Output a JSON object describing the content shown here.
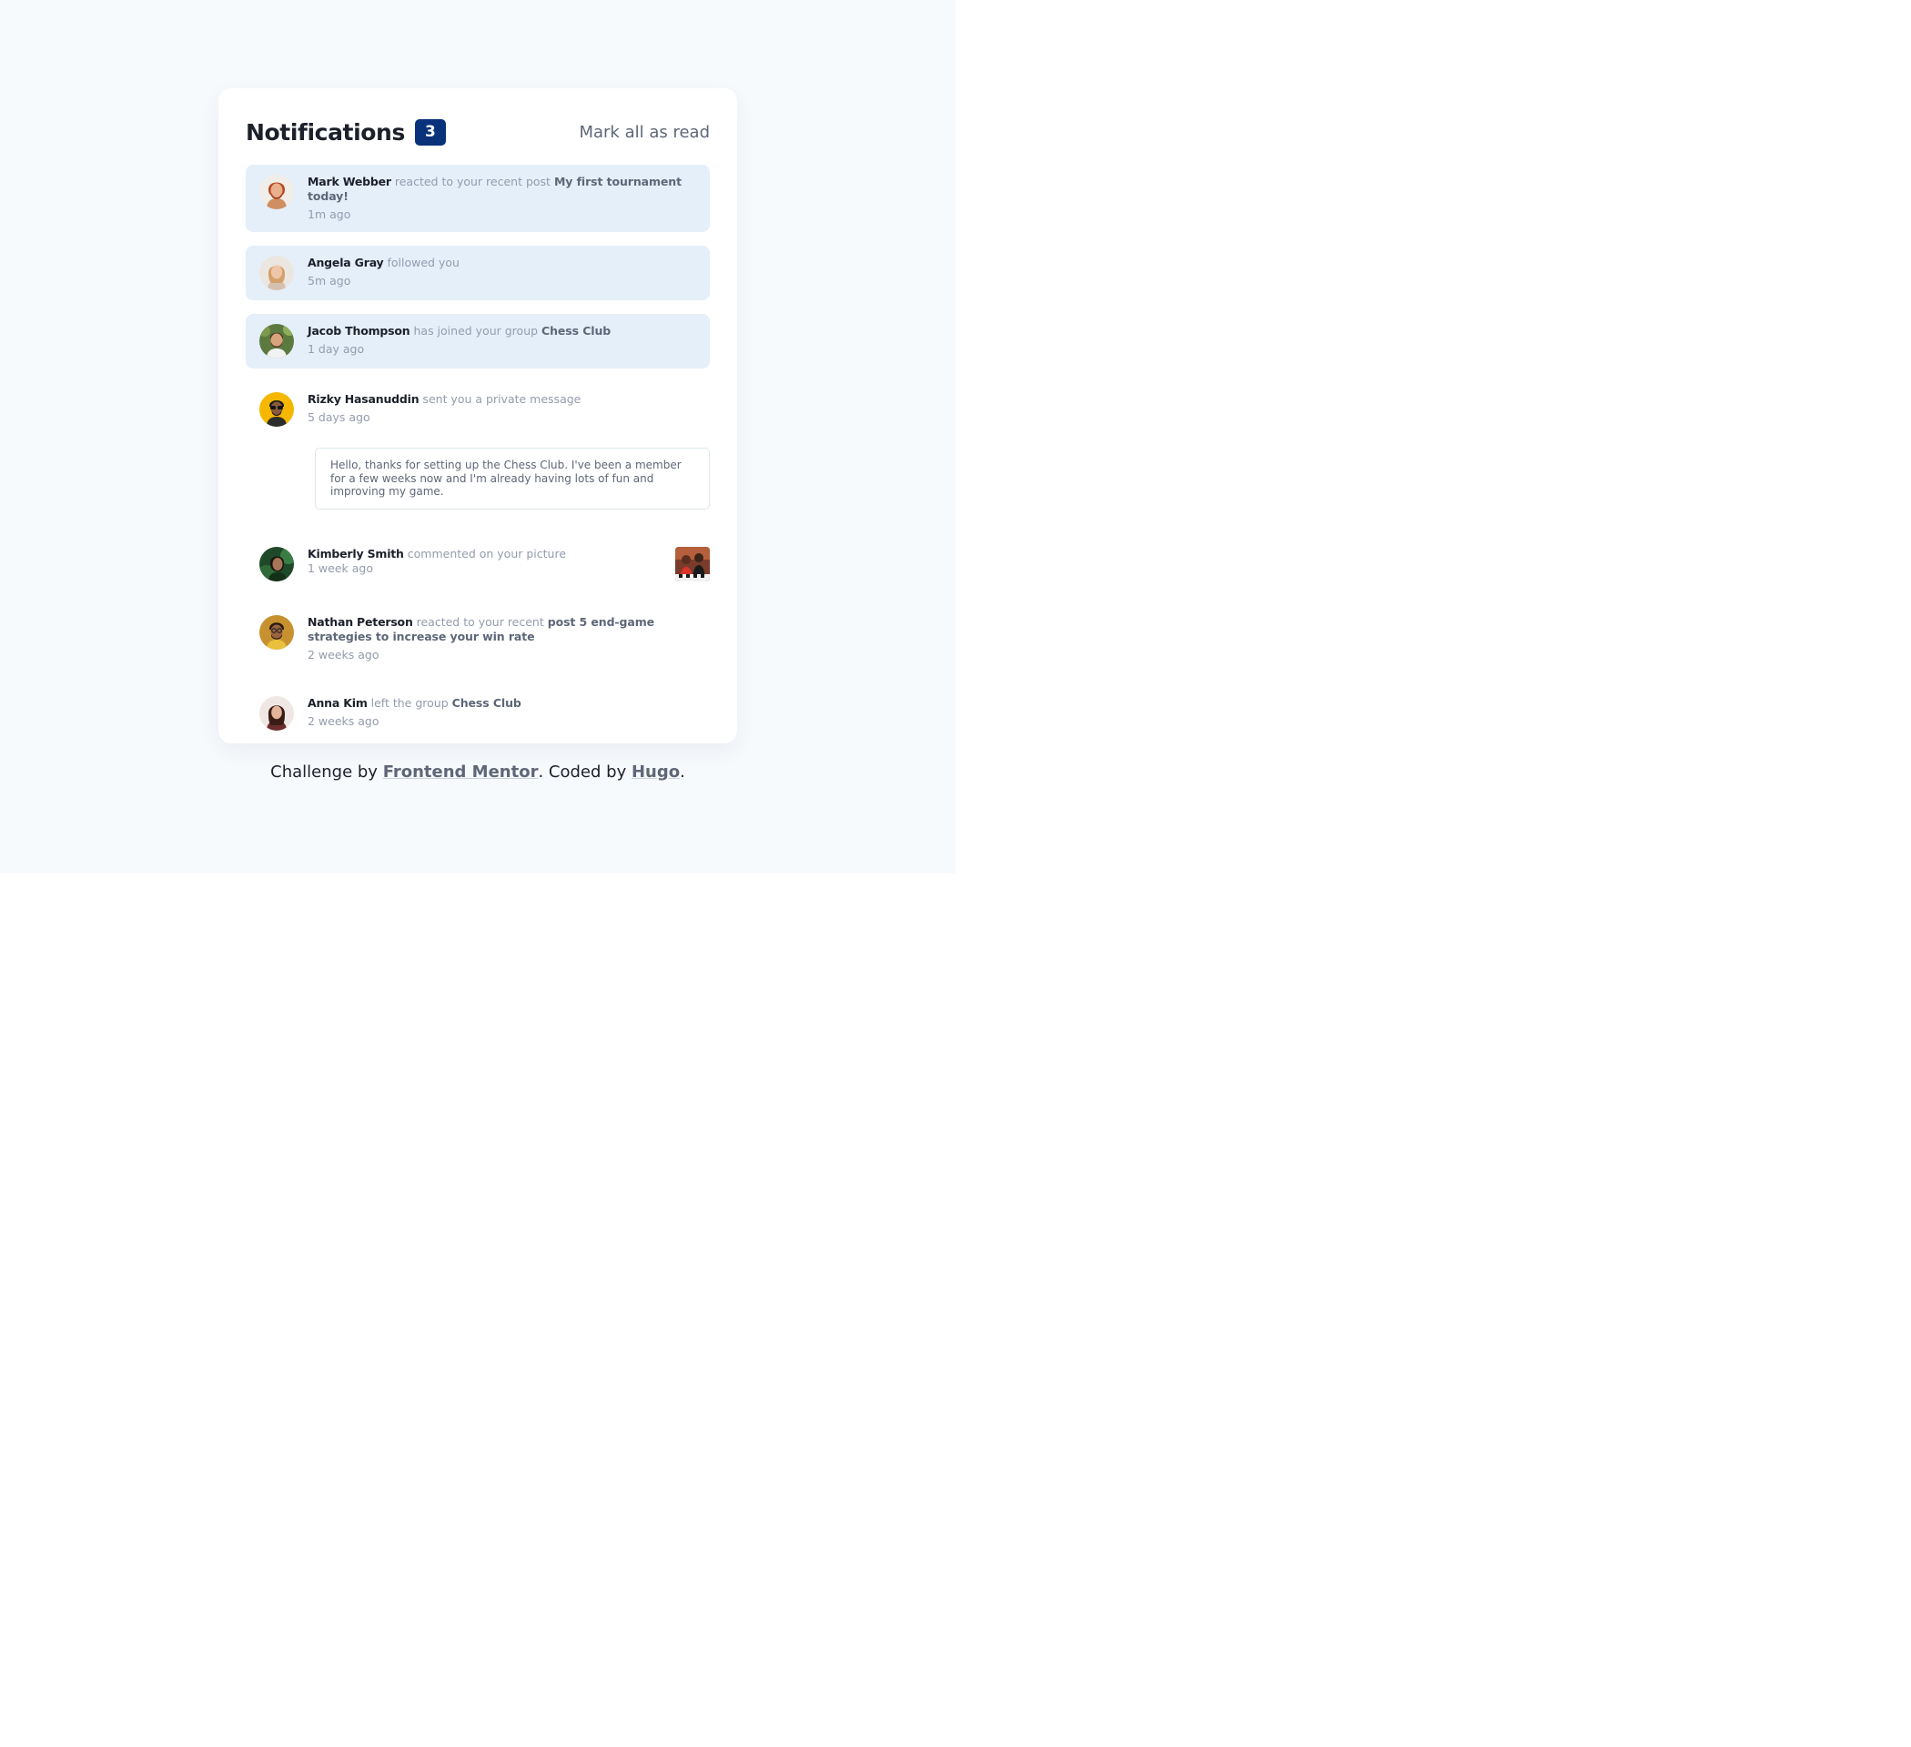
{
  "header": {
    "title": "Notifications",
    "unread_count": "3",
    "mark_all_label": "Mark all as read"
  },
  "notifications": [
    {
      "name": "Mark Webber",
      "action": "reacted to your recent post",
      "target": "My first tournament today!",
      "time": "1m ago",
      "unread": true,
      "avatar_icon": "avatar-mark-webber"
    },
    {
      "name": "Angela Gray",
      "action": "followed you",
      "target": "",
      "time": "5m ago",
      "unread": true,
      "avatar_icon": "avatar-angela-gray"
    },
    {
      "name": "Jacob Thompson",
      "action": "has joined your group",
      "target": "Chess Club",
      "time": "1 day ago",
      "unread": true,
      "avatar_icon": "avatar-jacob-thompson"
    },
    {
      "name": "Rizky Hasanuddin",
      "action": "sent you a private message",
      "target": "",
      "time": "5 days ago",
      "unread": false,
      "avatar_icon": "avatar-rizky-hasanuddin",
      "message": "Hello, thanks for setting up the Chess Club. I've been a member for a few weeks now and I'm already having lots of fun and improving my game."
    },
    {
      "name": "Kimberly Smith",
      "action": "commented on your picture",
      "target": "",
      "time": "1 week ago",
      "unread": false,
      "avatar_icon": "avatar-kimberly-smith",
      "has_picture": true
    },
    {
      "name": "Nathan Peterson",
      "action": "reacted to your recent",
      "target": "post 5 end-game strategies to increase your win rate",
      "time": "2 weeks ago",
      "unread": false,
      "avatar_icon": "avatar-nathan-peterson"
    },
    {
      "name": "Anna Kim",
      "action": "left the group",
      "target": "Chess Club",
      "time": "2 weeks ago",
      "unread": false,
      "avatar_icon": "avatar-anna-kim"
    }
  ],
  "footer": {
    "prefix": "Challenge by",
    "link1": "Frontend Mentor",
    "middle": ". Coded by",
    "link2": "Hugo",
    "suffix": "."
  },
  "colors": {
    "page_background": "#f7fafd",
    "card_background": "#ffffff",
    "unread_background": "#e5effa",
    "badge": "#0a327b",
    "heading": "#1c202b",
    "muted": "#939cad",
    "secondary": "#5e6778"
  }
}
